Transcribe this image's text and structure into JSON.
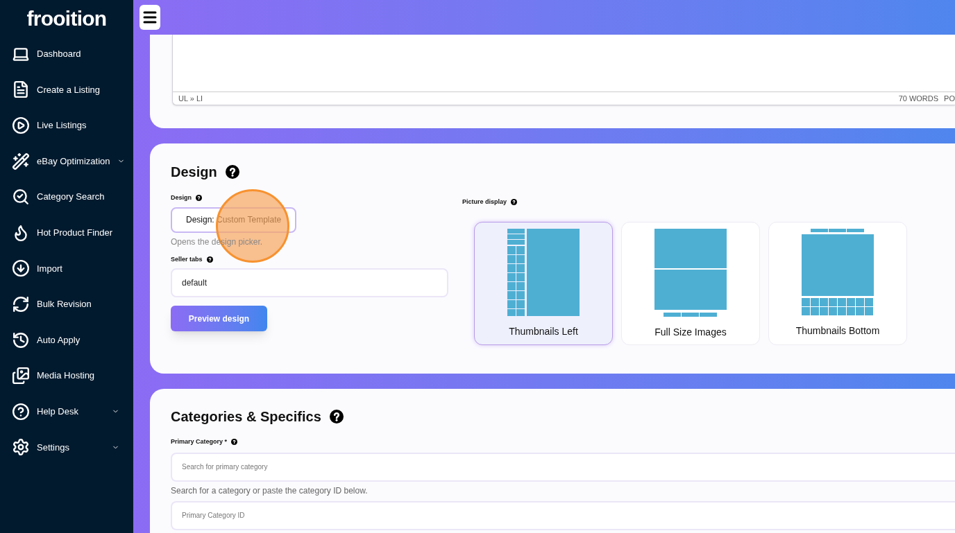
{
  "brand": {
    "logo": "frooition"
  },
  "sidebar": {
    "items": [
      {
        "label": "Dashboard",
        "expandable": false
      },
      {
        "label": "Create a Listing",
        "expandable": false
      },
      {
        "label": "Live Listings",
        "expandable": false
      },
      {
        "label": "eBay Optimization",
        "expandable": true
      },
      {
        "label": "Category Search",
        "expandable": false
      },
      {
        "label": "Hot Product Finder",
        "expandable": false
      },
      {
        "label": "Import",
        "expandable": false
      },
      {
        "label": "Bulk Revision",
        "expandable": false
      },
      {
        "label": "Auto Apply",
        "expandable": false
      },
      {
        "label": "Media Hosting",
        "expandable": false
      },
      {
        "label": "Help Desk",
        "expandable": true
      },
      {
        "label": "Settings",
        "expandable": true
      }
    ]
  },
  "editor": {
    "path": "UL » LI",
    "word_count": "70 WORDS",
    "status_cut": "PO"
  },
  "design": {
    "title": "Design",
    "design_label": "Design",
    "design_button": "Design: Custom Template",
    "design_hint": "Opens the design picker.",
    "seller_tabs_label": "Seller tabs",
    "seller_tabs_value": "default",
    "preview_button": "Preview design",
    "picture_display_label": "Picture display",
    "picture_options": [
      {
        "label": "Thumbnails Left",
        "kind": "left",
        "selected": true
      },
      {
        "label": "Full Size Images",
        "kind": "full",
        "selected": false
      },
      {
        "label": "Thumbnails Bottom",
        "kind": "bottom",
        "selected": false
      }
    ]
  },
  "categories": {
    "title": "Categories & Specifics",
    "primary_label": "Primary Category *",
    "search_placeholder": "Search for primary category",
    "hint": "Search for a category or paste the category ID below.",
    "id_placeholder": "Primary Category ID"
  }
}
